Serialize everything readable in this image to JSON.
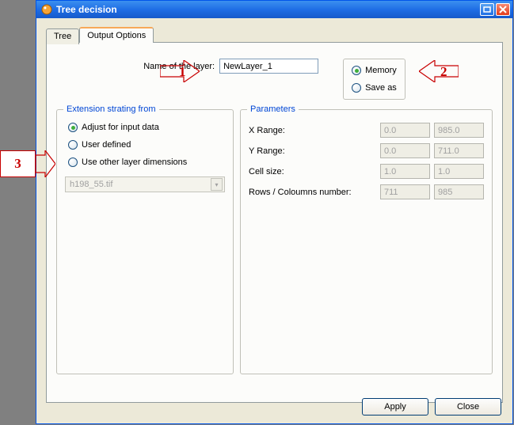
{
  "window": {
    "title": "Tree decision"
  },
  "tabs": {
    "tree": "Tree",
    "output": "Output Options"
  },
  "layer": {
    "label": "Name of the layer:",
    "value": "NewLayer_1"
  },
  "storage": {
    "memory": "Memory",
    "saveas": "Save as"
  },
  "extent": {
    "legend": "Extension strating from",
    "adjust": "Adjust for input data",
    "user": "User defined",
    "other": "Use other layer dimensions",
    "combo": "h198_55.tif"
  },
  "params": {
    "legend": "Parameters",
    "xrange_label": "X Range:",
    "yrange_label": "Y Range:",
    "cell_label": "Cell size:",
    "rows_label": "Rows / Coloumns number:",
    "x0": "0.0",
    "x1": "985.0",
    "y0": "0.0",
    "y1": "711.0",
    "c0": "1.0",
    "c1": "1.0",
    "r0": "711",
    "r1": "985"
  },
  "buttons": {
    "apply": "Apply",
    "close": "Close"
  },
  "annot": {
    "n1": "1",
    "n2": "2",
    "n3": "3"
  }
}
